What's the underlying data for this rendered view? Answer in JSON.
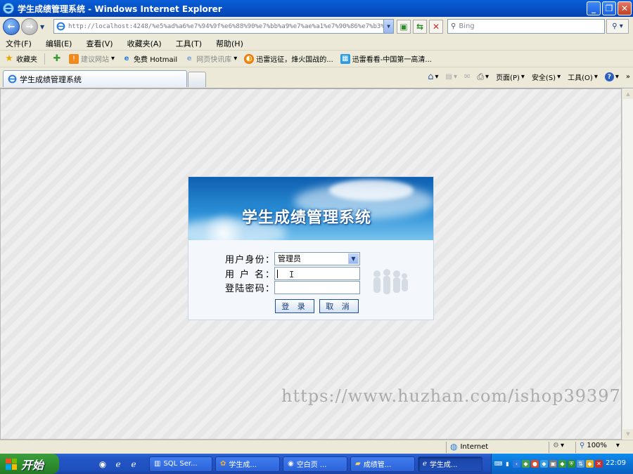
{
  "window": {
    "title": "学生成绩管理系统 - Windows Internet Explorer"
  },
  "address": {
    "url": "http://localhost:4248/%e5%ad%a6%e7%94%9f%e6%88%90%e7%bb%a9%e7%ae%a1%e7%90%86%e7%b3%bb"
  },
  "search": {
    "placeholder": "Bing"
  },
  "menu": [
    "文件(F)",
    "编辑(E)",
    "查看(V)",
    "收藏夹(A)",
    "工具(T)",
    "帮助(H)"
  ],
  "favorites": {
    "label": "收藏夹",
    "items": [
      "建议网站",
      "免费 Hotmail",
      "网页快讯库",
      "迅雷远征，烽火国战的...",
      "迅雷看看-中国第一高清..."
    ]
  },
  "tab": {
    "title": "学生成绩管理系统"
  },
  "commands": {
    "page": "页面(P)",
    "safety": "安全(S)",
    "tools": "工具(O)"
  },
  "login": {
    "banner_title": "学生成绩管理系统",
    "role_label": "用户身份：",
    "role_value": "管理员",
    "username_label": "用 户 名：",
    "username_value": "",
    "password_label": "登陆密码：",
    "password_value": "",
    "login_button": "登 录",
    "cancel_button": "取 消"
  },
  "watermark": "https://www.huzhan.com/ishop39397",
  "status": {
    "zone": "Internet",
    "zoom": "100%"
  },
  "taskbar": {
    "start": "开始",
    "tasks": [
      "SQL Ser...",
      "学生成...",
      "空白页 ...",
      "成绩管...",
      "学生成..."
    ],
    "clock": "22:09"
  },
  "colors": {
    "title_bar": "#0a5fd8",
    "start_button": "#3c9e3c",
    "banner": "#2a8fd6",
    "button_border": "#1e4f93"
  }
}
